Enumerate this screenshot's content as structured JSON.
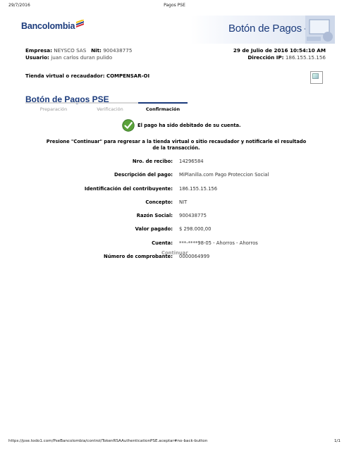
{
  "print_header": {
    "date": "29/7/2016",
    "title": "Pagos PSE"
  },
  "brand": {
    "name": "Bancolombia",
    "banner_title": "Botón de Pagos – PSE",
    "color": "#1b3b7c"
  },
  "info": {
    "empresa_label": "Empresa:",
    "empresa_value": "NEYSCO SAS",
    "nit_label": "Nit:",
    "nit_value": "900438775",
    "datetime": "29 de Julio de 2016 10:54:10 AM",
    "usuario_label": "Usuario:",
    "usuario_value": "juan carlos duran pulido",
    "ip_label": "Dirección IP:",
    "ip_value": "186.155.15.156"
  },
  "store": {
    "label": "Tienda virtual o recaudador:",
    "value": "COMPENSAR-OI"
  },
  "section_title": "Botón de Pagos PSE",
  "steps": [
    "Preparación",
    "Verificación",
    "Confirmación"
  ],
  "success_message": "El pago ha sido debitado de su cuenta.",
  "instruction": "Presione \"Continuar\" para regresar a la tienda virtual o sitio recaudador y notificarle el resultado de la transacción.",
  "details": [
    {
      "label": "Nro. de recibo:",
      "value": "14296584"
    },
    {
      "label": "Descripción del pago:",
      "value": "MiPlanilla.com Pago Proteccion Social"
    },
    {
      "label": "Identificación del contribuyente:",
      "value": "186.155.15.156"
    },
    {
      "label": "Concepto:",
      "value": "NIT"
    },
    {
      "label": "Razón Social:",
      "value": "900438775"
    },
    {
      "label": "Valor pagado:",
      "value": "$ 298.000,00"
    },
    {
      "label": "Cuenta:",
      "value": "***-****98-05 - Ahorros - Ahorros"
    },
    {
      "label": "Número de comprobante:",
      "value": "0000064999"
    }
  ],
  "continue_label": "Continuar",
  "print_footer": {
    "url": "https://pse.todo1.com/PseBancolombia/control/TokenRSAAuthenticationPSE.aceptar#no-back-button",
    "page": "1/1"
  }
}
